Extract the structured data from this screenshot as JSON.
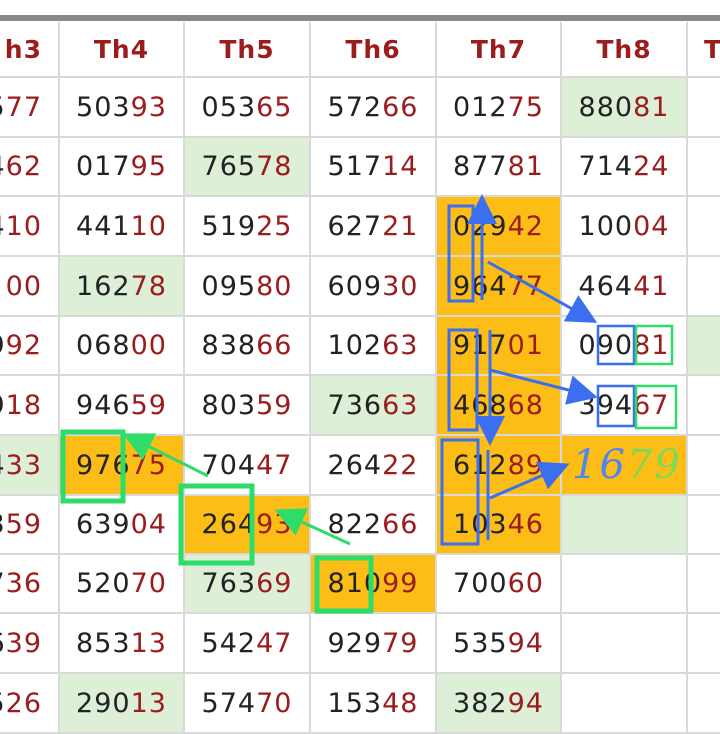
{
  "columns": [
    "h3",
    "Th4",
    "Th5",
    "Th6",
    "Th7",
    "Th8",
    "T"
  ],
  "rows": [
    [
      "577",
      "50393",
      "05365",
      "57266",
      "01275",
      "88081",
      ""
    ],
    [
      "462",
      "01795",
      "76578",
      "51714",
      "87781",
      "71424",
      ""
    ],
    [
      "410",
      "44110",
      "51925",
      "62721",
      "02942",
      "10004",
      ""
    ],
    [
      "00",
      "16278",
      "09580",
      "60930",
      "96477",
      "46441",
      ""
    ],
    [
      "992",
      "06800",
      "83866",
      "10263",
      "91701",
      "09081",
      ""
    ],
    [
      "918",
      "94659",
      "80359",
      "73663",
      "46868",
      "39467",
      ""
    ],
    [
      "433",
      "97675",
      "70447",
      "26422",
      "61289",
      "",
      ""
    ],
    [
      "359",
      "63904",
      "26493",
      "82266",
      "10346",
      "",
      ""
    ],
    [
      "736",
      "52070",
      "76369",
      "81099",
      "70060",
      "",
      ""
    ],
    [
      "639",
      "85313",
      "54247",
      "92979",
      "53594",
      "",
      ""
    ],
    [
      "526",
      "29013",
      "57470",
      "15348",
      "38294",
      "",
      ""
    ]
  ],
  "highlights": {
    "green": [
      [
        0,
        5
      ],
      [
        1,
        2
      ],
      [
        3,
        1
      ],
      [
        4,
        6
      ],
      [
        5,
        3
      ],
      [
        6,
        0
      ],
      [
        7,
        5
      ],
      [
        8,
        2
      ],
      [
        10,
        1
      ],
      [
        10,
        4
      ]
    ],
    "orange": [
      [
        2,
        4
      ],
      [
        3,
        4
      ],
      [
        4,
        4
      ],
      [
        5,
        4
      ],
      [
        6,
        1
      ],
      [
        6,
        4
      ],
      [
        6,
        5
      ],
      [
        7,
        2
      ],
      [
        7,
        4
      ],
      [
        8,
        3
      ]
    ]
  },
  "handwritten_note": "1679",
  "annotation_colors": {
    "blue": "#3b6ff0",
    "green": "#2fdc6a",
    "note_blue": "#4f86f0",
    "note_green": "#7ed957"
  }
}
